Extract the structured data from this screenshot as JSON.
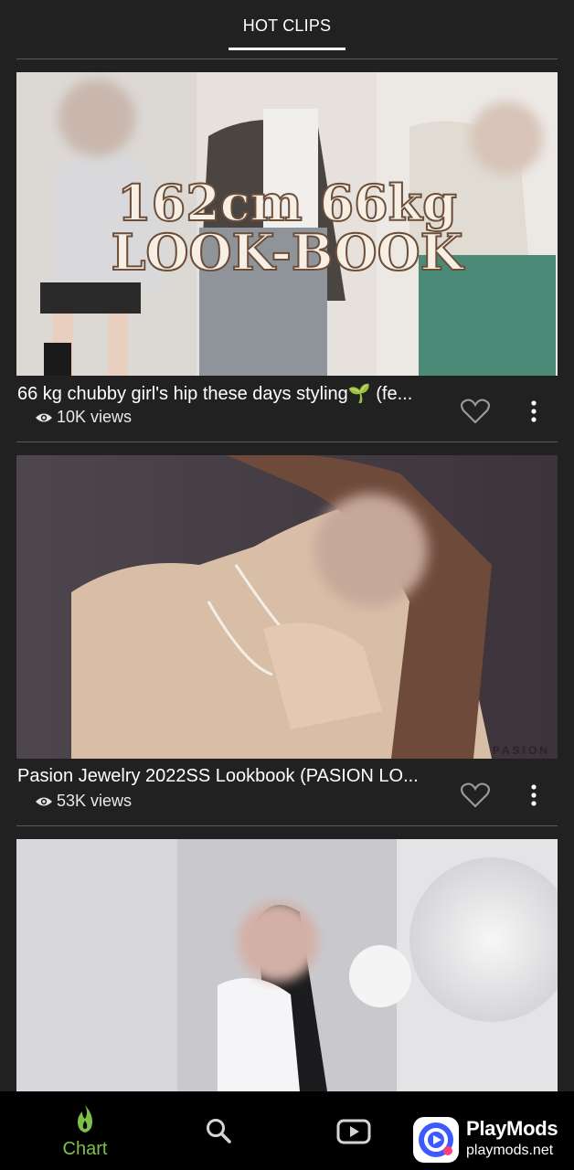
{
  "top_tabs": {
    "active": "HOT CLIPS"
  },
  "clips": [
    {
      "title": "66 kg chubby girl's hip these days styling🌱 (fe...",
      "views": "10K views",
      "thumbnail_text": [
        "162cm 66kg",
        "LOOK-BOOK"
      ],
      "liked": false
    },
    {
      "title": "Pasion Jewelry 2022SS Lookbook (PASION LO...",
      "views": "53K views",
      "thumbnail_text": [
        "PASION"
      ],
      "liked": false
    },
    {
      "title": "",
      "views": "",
      "thumbnail_text": [],
      "liked": false
    }
  ],
  "bottom_nav": {
    "items": [
      {
        "label": "Chart",
        "icon": "flame-icon",
        "active": true
      },
      {
        "label": "",
        "icon": "search-icon",
        "active": false
      },
      {
        "label": "",
        "icon": "video-play-icon",
        "active": false
      }
    ],
    "active_color": "#7cc04a"
  },
  "watermark": {
    "name": "PlayMods",
    "url": "playmods.net"
  },
  "colors": {
    "background": "#222122",
    "divider": "#5a595a",
    "nav_background": "#000000"
  }
}
